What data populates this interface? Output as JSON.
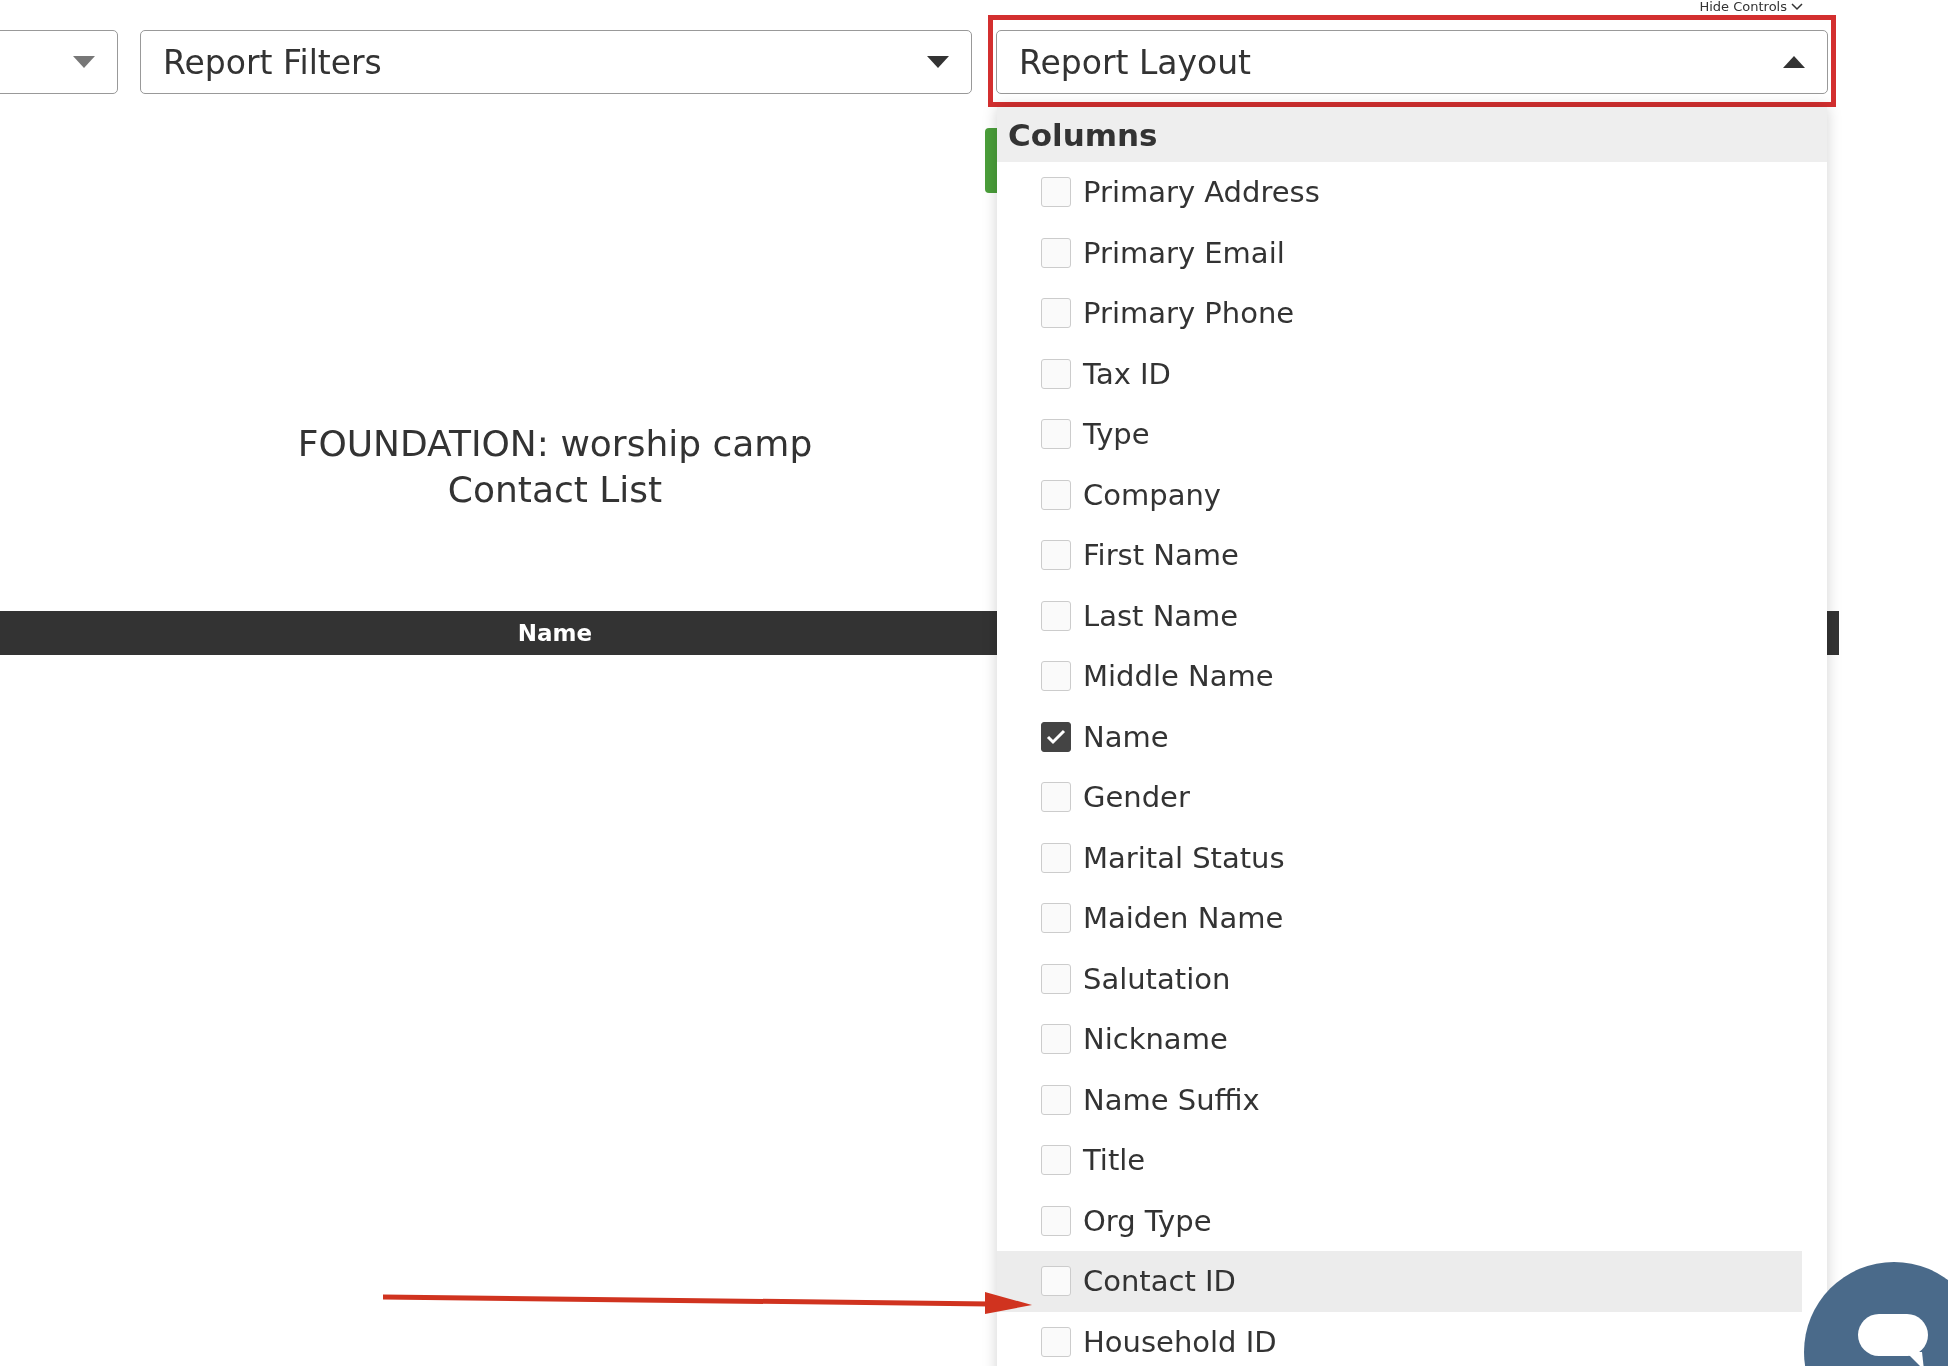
{
  "hide_controls": {
    "label": "Hide Controls"
  },
  "dropdowns": [
    {
      "expanded": false
    },
    {
      "label": "Report Filters",
      "expanded": false
    },
    {
      "label": "Report Layout",
      "expanded": true
    }
  ],
  "report": {
    "title": "FOUNDATION: worship camp",
    "subtitle": "Contact List"
  },
  "table": {
    "columns": [
      "Name"
    ]
  },
  "layout_menu": {
    "section": "Columns",
    "items": [
      {
        "label": "Primary Address",
        "checked": false,
        "highlighted": false
      },
      {
        "label": "Primary Email",
        "checked": false,
        "highlighted": false
      },
      {
        "label": "Primary Phone",
        "checked": false,
        "highlighted": false
      },
      {
        "label": "Tax ID",
        "checked": false,
        "highlighted": false
      },
      {
        "label": "Type",
        "checked": false,
        "highlighted": false
      },
      {
        "label": "Company",
        "checked": false,
        "highlighted": false
      },
      {
        "label": "First Name",
        "checked": false,
        "highlighted": false
      },
      {
        "label": "Last Name",
        "checked": false,
        "highlighted": false
      },
      {
        "label": "Middle Name",
        "checked": false,
        "highlighted": false
      },
      {
        "label": "Name",
        "checked": true,
        "highlighted": false
      },
      {
        "label": "Gender",
        "checked": false,
        "highlighted": false
      },
      {
        "label": "Marital Status",
        "checked": false,
        "highlighted": false
      },
      {
        "label": "Maiden Name",
        "checked": false,
        "highlighted": false
      },
      {
        "label": "Salutation",
        "checked": false,
        "highlighted": false
      },
      {
        "label": "Nickname",
        "checked": false,
        "highlighted": false
      },
      {
        "label": "Name Suffix",
        "checked": false,
        "highlighted": false
      },
      {
        "label": "Title",
        "checked": false,
        "highlighted": false
      },
      {
        "label": "Org Type",
        "checked": false,
        "highlighted": false
      },
      {
        "label": "Contact ID",
        "checked": false,
        "highlighted": true
      },
      {
        "label": "Household ID",
        "checked": false,
        "highlighted": false
      }
    ]
  }
}
